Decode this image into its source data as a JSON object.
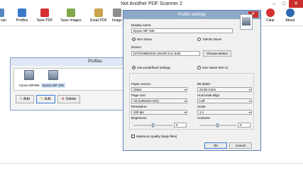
{
  "window": {
    "title": "Not Another PDF Scanner 2"
  },
  "toolbar": {
    "scan": {
      "label": "can",
      "color": "#5a86c4"
    },
    "profiles": {
      "label": "Profiles",
      "color": "#3b79c8"
    },
    "save_pdf": {
      "label": "Save PDF",
      "color": "#d43030"
    },
    "save_images": {
      "label": "Save Images",
      "color": "#7fa84a"
    },
    "email_pdf": {
      "label": "Email PDF",
      "color": "#c8a24a"
    },
    "image": {
      "label": "Image",
      "color": "#8d8d8d"
    },
    "clear": {
      "label": "Clear",
      "color": "#d43030"
    },
    "about": {
      "label": "About",
      "color": "#2f6ab4"
    }
  },
  "profiles_window": {
    "title": "Profiles",
    "devices": [
      {
        "label": "Canon MP495"
      },
      {
        "label": "Epson WF 845"
      }
    ],
    "buttons": {
      "add": "Add",
      "edit": "Edit",
      "delete": "Delete"
    }
  },
  "dialog": {
    "title": "Profile settings",
    "display_name_label": "Display name:",
    "display_name_value": "Epson WF 845",
    "wia_driver": "WIA Driver",
    "twain_driver": "TWAIN Driver",
    "device_label": "Device:",
    "device_value": "EPSON8B2E25 (WorkForce 845)",
    "choose_device": "Choose device",
    "use_predefined": "Use predefined settings",
    "use_native": "Use native WIA UI",
    "paper_source_label": "Paper source:",
    "paper_source_value": "Glass",
    "bit_depth_label": "Bit depth:",
    "bit_depth_value": "24-bit Color",
    "page_size_label": "Page size:",
    "page_size_value": "A5 (148x210 mm)",
    "horizontal_align_label": "Horizontal align:",
    "horizontal_align_value": "Left",
    "resolution_label": "Resolution:",
    "resolution_value": "100 dpi",
    "scale_label": "Scale:",
    "scale_value": "1:1",
    "brightness_label": "Brightness:",
    "brightness_value": "0",
    "contrast_label": "Contrast:",
    "contrast_value": "0",
    "max_quality": "Maximum quality (large files)",
    "ok": "OK",
    "cancel": "Cancel"
  }
}
